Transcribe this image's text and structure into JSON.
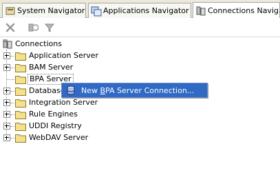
{
  "tabs": [
    {
      "label": "System Navigator",
      "icon": "system-navigator-icon",
      "active": false
    },
    {
      "label": "Applications Navigator",
      "icon": "applications-navigator-icon",
      "active": false
    },
    {
      "label": "Connections Navigator",
      "icon": "connections-navigator-icon",
      "active": true
    }
  ],
  "toolbar": {
    "icons": [
      "delete-icon",
      "refresh-icon",
      "filter-icon"
    ]
  },
  "tree": {
    "root_label": "Connections",
    "items": [
      {
        "label": "Application Server",
        "expandable": true
      },
      {
        "label": "BAM Server",
        "expandable": true
      },
      {
        "label": "BPA Server",
        "expandable": false
      },
      {
        "label": "Database",
        "expandable": true
      },
      {
        "label": "Integration Server",
        "expandable": true
      },
      {
        "label": "Rule Engines",
        "expandable": true
      },
      {
        "label": "UDDI Registry",
        "expandable": true
      },
      {
        "label": "WebDAV Server",
        "expandable": true
      }
    ]
  },
  "context_menu": {
    "items": [
      {
        "label_pre": "New ",
        "label_mnemonic": "B",
        "label_post": "PA Server Connection..."
      }
    ]
  }
}
